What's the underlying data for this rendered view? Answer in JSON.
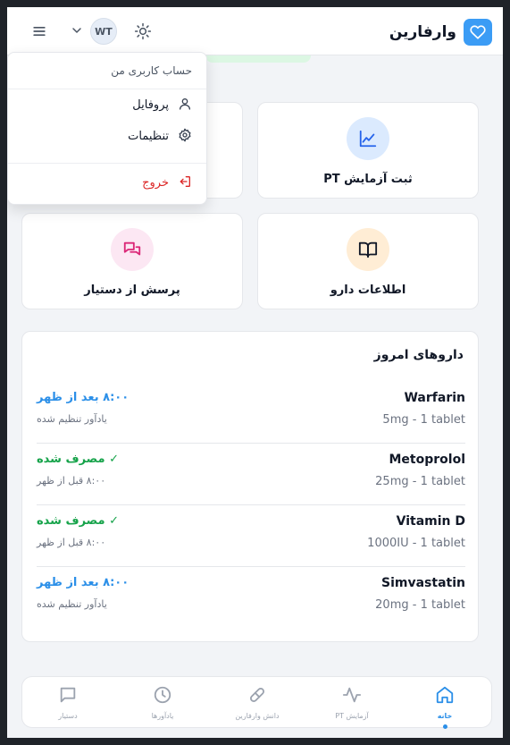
{
  "header": {
    "brand_name": "وارفارین",
    "avatar_initials": "WT"
  },
  "user_menu": {
    "title": "حساب کاربری من",
    "items": [
      {
        "label": "پروفایل",
        "icon": "user-icon"
      },
      {
        "label": "تنظیمات",
        "icon": "gear-icon"
      }
    ],
    "logout_label": "خروج"
  },
  "tiles": [
    {
      "label": "ثبت آزمایش PT",
      "icon": "chart-line-icon",
      "icon_bg": "#dbeafe",
      "icon_color": "#2563eb"
    },
    {
      "label": "اطلاعات دارو",
      "icon": "book-icon",
      "icon_bg": "#ffedd5",
      "icon_color": "#111827"
    },
    {
      "label": "پرسش از دستیار",
      "icon": "chat-icon",
      "icon_bg": "#fce7f3",
      "icon_color": "#db2777"
    }
  ],
  "todays_meds": {
    "title": "داروهای امروز",
    "rows": [
      {
        "name": "Warfarin",
        "dose": "5mg - 1 tablet",
        "status": "۸:۰۰ بعد از ظهر",
        "sub": "یادآور تنظیم شده",
        "status_color": "#2b8fe8"
      },
      {
        "name": "Metoprolol",
        "dose": "25mg - 1 tablet",
        "status": "✓ مصرف شده",
        "sub": "۸:۰۰ قبل از ظهر",
        "status_color": "#16a34a"
      },
      {
        "name": "Vitamin D",
        "dose": "1000IU - 1 tablet",
        "status": "✓ مصرف شده",
        "sub": "۸:۰۰ قبل از ظهر",
        "status_color": "#16a34a"
      },
      {
        "name": "Simvastatin",
        "dose": "20mg - 1 tablet",
        "status": "۸:۰۰ بعد از ظهر",
        "sub": "یادآور تنظیم شده",
        "status_color": "#2b8fe8"
      }
    ]
  },
  "bottom_nav": [
    {
      "label": "خانه",
      "icon": "home-icon",
      "active": true
    },
    {
      "label": "آزمایش PT",
      "icon": "activity-icon",
      "active": false
    },
    {
      "label": "دانش وارفارین",
      "icon": "pill-icon",
      "active": false
    },
    {
      "label": "یادآورها",
      "icon": "clock-icon",
      "active": false
    },
    {
      "label": "دستیار",
      "icon": "chat-icon",
      "active": false
    }
  ],
  "colors": {
    "accent": "#2b8fe8",
    "success": "#16a34a",
    "danger": "#dc2626"
  }
}
